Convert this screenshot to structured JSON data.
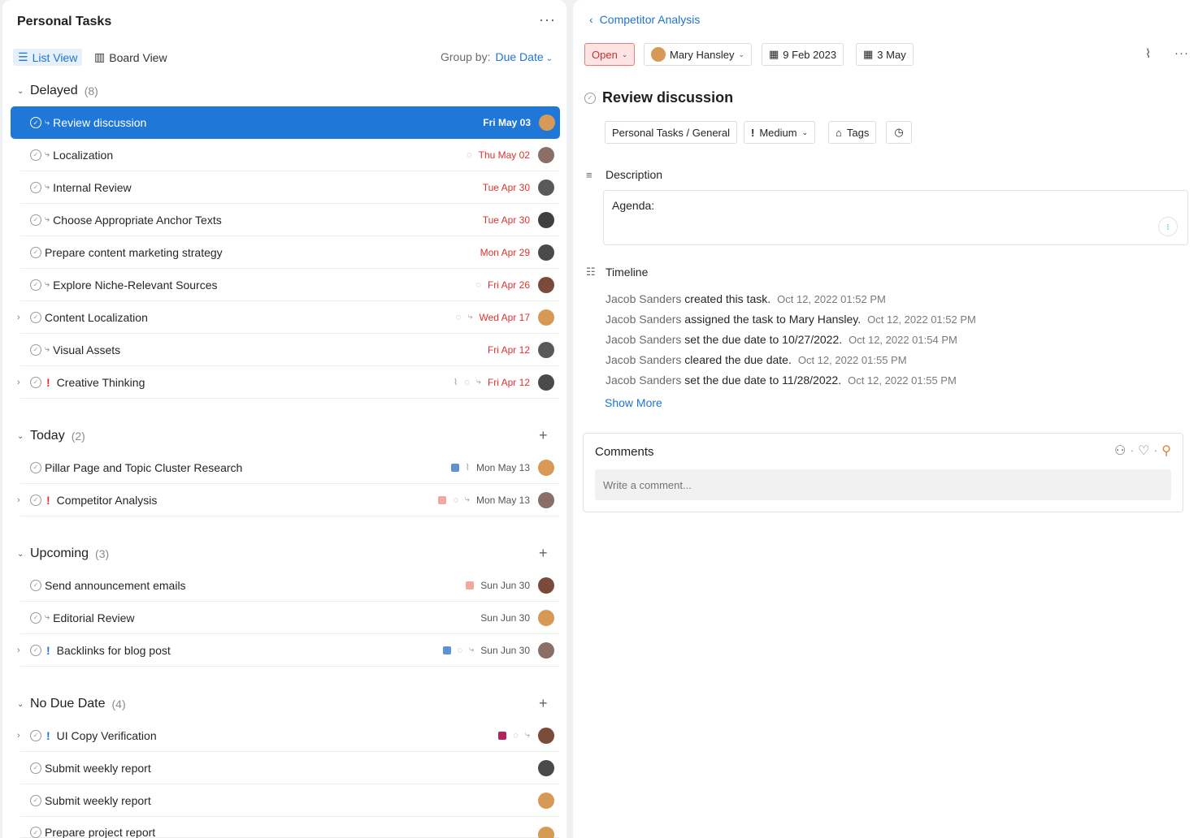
{
  "left": {
    "title": "Personal Tasks",
    "more": "···",
    "views": {
      "list": "List View",
      "board": "Board View"
    },
    "group_by": {
      "label": "Group by:",
      "value": "Due Date"
    },
    "sections": {
      "delayed": {
        "label": "Delayed",
        "count": "(8)"
      },
      "today": {
        "label": "Today",
        "count": "(2)"
      },
      "upcoming": {
        "label": "Upcoming",
        "count": "(3)"
      },
      "nodue": {
        "label": "No Due Date",
        "count": "(4)"
      }
    },
    "tasks": {
      "t1": {
        "name": "Review discussion",
        "date": "Fri May 03"
      },
      "t2": {
        "name": "Localization",
        "date": "Thu May 02"
      },
      "t3": {
        "name": "Internal Review",
        "date": "Tue Apr 30"
      },
      "t4": {
        "name": "Choose Appropriate Anchor Texts",
        "date": "Tue Apr 30"
      },
      "t5": {
        "name": "Prepare content marketing strategy",
        "date": "Mon Apr 29"
      },
      "t6": {
        "name": "Explore Niche-Relevant Sources",
        "date": "Fri Apr 26"
      },
      "t7": {
        "name": "Content Localization",
        "date": "Wed Apr 17"
      },
      "t8": {
        "name": "Visual Assets",
        "date": "Fri Apr 12"
      },
      "t9": {
        "name": "Creative Thinking",
        "date": "Fri Apr 12"
      },
      "t10": {
        "name": "Pillar Page and Topic Cluster Research",
        "date": "Mon May 13"
      },
      "t11": {
        "name": "Competitor Analysis",
        "date": "Mon May 13"
      },
      "t12": {
        "name": "Send announcement emails",
        "date": "Sun Jun 30"
      },
      "t13": {
        "name": "Editorial Review",
        "date": "Sun Jun 30"
      },
      "t14": {
        "name": "Backlinks for blog post",
        "date": "Sun Jun 30"
      },
      "t15": {
        "name": "UI Copy Verification",
        "date": ""
      },
      "t16": {
        "name": "Submit weekly report",
        "date": ""
      },
      "t17": {
        "name": "Submit weekly report",
        "date": ""
      },
      "t18": {
        "name": "Prepare project report",
        "date": ""
      }
    },
    "priority_mark": "!"
  },
  "right": {
    "breadcrumb": "Competitor Analysis",
    "status": "Open",
    "assignee": "Mary Hansley",
    "start_date": "9 Feb 2023",
    "due_date": "3 May",
    "task_title": "Review discussion",
    "project": "Personal Tasks / General",
    "priority": "Medium",
    "tags": "Tags",
    "description_label": "Description",
    "description_text": "Agenda:",
    "timeline_label": "Timeline",
    "timeline": [
      {
        "who": "Jacob Sanders",
        "action": " created this task.",
        "when": "Oct 12, 2022 01:52 PM"
      },
      {
        "who": "Jacob Sanders",
        "action": " assigned the task to Mary Hansley.",
        "when": "Oct 12, 2022 01:52 PM"
      },
      {
        "who": "Jacob Sanders",
        "action": " set the due date to 10/27/2022.",
        "when": "Oct 12, 2022 01:54 PM"
      },
      {
        "who": "Jacob Sanders",
        "action": " cleared the due date.",
        "when": "Oct 12, 2022 01:55 PM"
      },
      {
        "who": "Jacob Sanders",
        "action": " set the due date to 11/28/2022.",
        "when": "Oct 12, 2022 01:55 PM"
      }
    ],
    "show_more": "Show More",
    "comments_label": "Comments",
    "comment_placeholder": "Write a comment..."
  },
  "colors": {
    "accent": "#1f78d8",
    "overdue": "#e0322d",
    "tag_blue": "#5b93d8",
    "tag_salmon": "#f2a7a0",
    "tag_magenta": "#b3245f"
  }
}
